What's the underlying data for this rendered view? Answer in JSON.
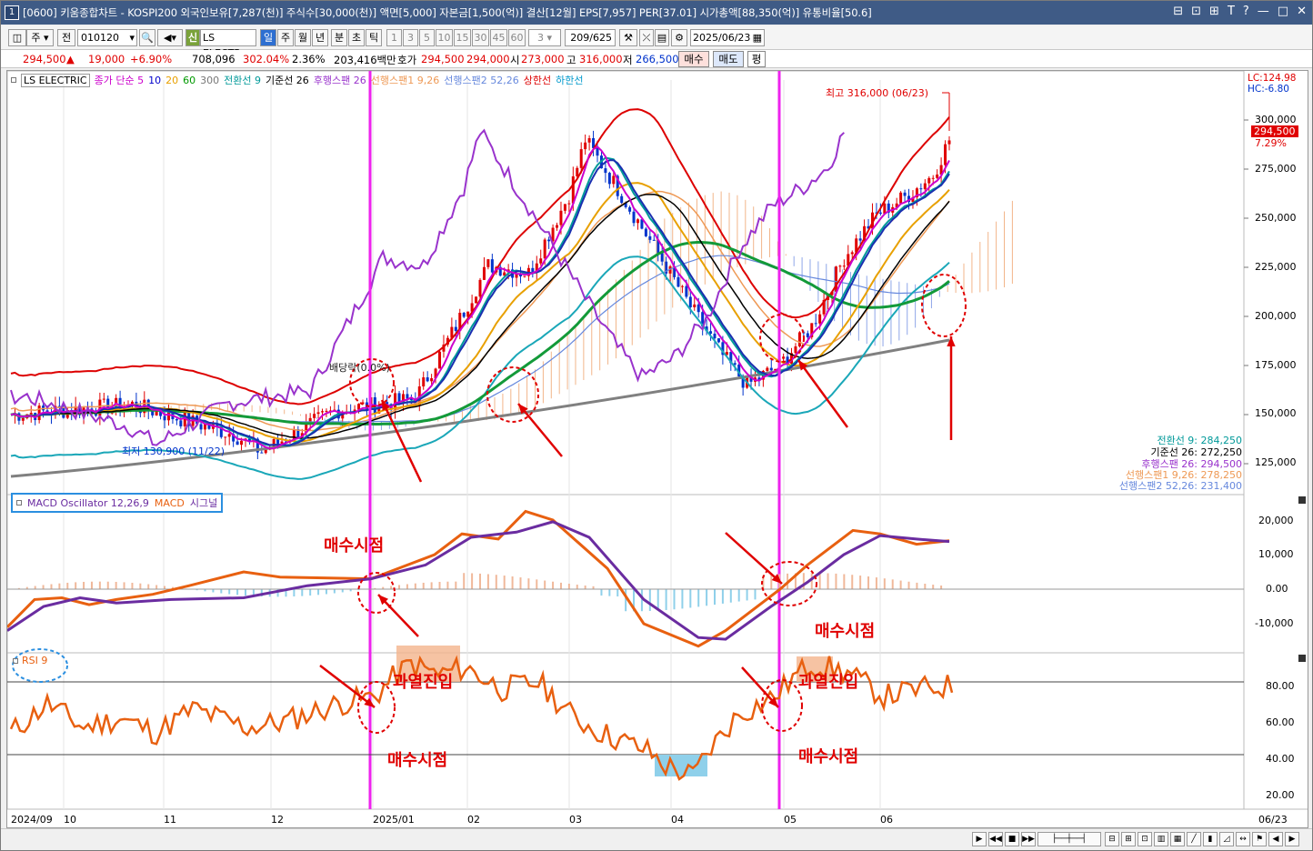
{
  "window": {
    "number": "1",
    "title": "[0600] 키움종합차트 - KOSPI200 외국인보유[7,287(천)] 주식수[30,000(천)] 액면[5,000] 자본금[1,500(억)] 결산[12월] EPS[7,957] PER[37.01] 시가총액[88,350(억)] 유통비율[50.6]",
    "controls": [
      "⊟",
      "⊡",
      "⊞",
      "T",
      "?",
      "—",
      "□",
      "✕"
    ]
  },
  "toolbar": {
    "market_tab": "주",
    "scope_tab": "전",
    "stock_code": "010120",
    "stock_name": "LS ELECTR",
    "badge": "신",
    "periods": [
      "일",
      "주",
      "월",
      "년",
      "분",
      "초",
      "틱"
    ],
    "active_period": "일",
    "minutes": [
      "1",
      "3",
      "5",
      "10",
      "15",
      "30",
      "45",
      "60"
    ],
    "minute_value": "3",
    "range": "209/625",
    "date": "2025/06/23"
  },
  "quote": {
    "price": "294,500",
    "change_arrow": "▲",
    "change": "19,000",
    "change_pct": "+6.90%",
    "volume": "708,096",
    "volume_ratio": "302.04%",
    "turnover": "2.36%",
    "amount": "203,416백만",
    "ask_label": "호가",
    "ask": "294,500",
    "bid": "294,000",
    "open_label": "시",
    "open": "273,000",
    "high_label": "고",
    "high": "316,000",
    "low_label": "저",
    "low": "266,500",
    "buy_btn": "매수",
    "sell_btn": "매도",
    "avg_btn": "평"
  },
  "price_panel": {
    "legend": [
      {
        "text": "LS ELECTRIC",
        "color": "#333333"
      },
      {
        "text": "종가 단순 5",
        "color": "#cc00cc"
      },
      {
        "text": "10",
        "color": "#0000cc"
      },
      {
        "text": "20",
        "color": "#e8a000"
      },
      {
        "text": "60",
        "color": "#009900"
      },
      {
        "text": "300",
        "color": "#777777"
      },
      {
        "text": "전환선 9",
        "color": "#009999"
      },
      {
        "text": "기준선 26",
        "color": "#000000"
      },
      {
        "text": "후행스팬 26",
        "color": "#9933cc"
      },
      {
        "text": "선행스팬1 9,26",
        "color": "#ee9955"
      },
      {
        "text": "선행스팬2 52,26",
        "color": "#6688dd"
      },
      {
        "text": "상한선",
        "color": "#dd0000"
      },
      {
        "text": "하한선",
        "color": "#0099cc"
      }
    ],
    "yticks": [
      "300,000",
      "275,000",
      "250,000",
      "225,000",
      "200,000",
      "175,000",
      "150,000",
      "125,000"
    ],
    "lc": "LC:124.98",
    "hc": "HC:-6.80",
    "current_price": "294,500",
    "current_pct": "7.29%",
    "high_annotation": "최고 316,000 (06/23)",
    "low_annotation": "최저 130,900 (11/22)",
    "dividend_label": "배당락(0.0%)",
    "values": [
      {
        "text": "전환선 9: 284,250",
        "color": "#009999"
      },
      {
        "text": "기준선 26: 272,250",
        "color": "#000000"
      },
      {
        "text": "후행스팬 26: 294,500",
        "color": "#9933cc"
      },
      {
        "text": "선행스팬1 9,26: 278,250",
        "color": "#ee9955"
      },
      {
        "text": "선행스팬2 52,26: 231,400",
        "color": "#6688dd"
      }
    ]
  },
  "macd_panel": {
    "legend": [
      {
        "text": "MACD Oscillator 12,26,9",
        "color": "#6a2ca0"
      },
      {
        "text": "MACD",
        "color": "#e86010"
      },
      {
        "text": "시그널",
        "color": "#6a2ca0"
      }
    ],
    "yticks": [
      "20,000",
      "10,000",
      "0.00",
      "-10,000"
    ],
    "annotation_left": "매수시점",
    "annotation_right": "매수시점"
  },
  "rsi_panel": {
    "legend": "RSI 9",
    "yticks": [
      "80.00",
      "60.00",
      "40.00",
      "20.00"
    ],
    "label_overheat_left": "과열진입",
    "label_overheat_right": "과열진입",
    "label_buy_left": "매수시점",
    "label_buy_right": "매수시점"
  },
  "xaxis": {
    "labels": [
      "2024/09",
      "10",
      "11",
      "12",
      "2025/01",
      "02",
      "03",
      "04",
      "05",
      "06"
    ],
    "end_date": "06/23"
  },
  "colors": {
    "title_bg": "#3f5b86",
    "up": "#e00000",
    "down": "#0033cc",
    "marker_line": "#ee22ee",
    "annotation": "#e00000"
  }
}
